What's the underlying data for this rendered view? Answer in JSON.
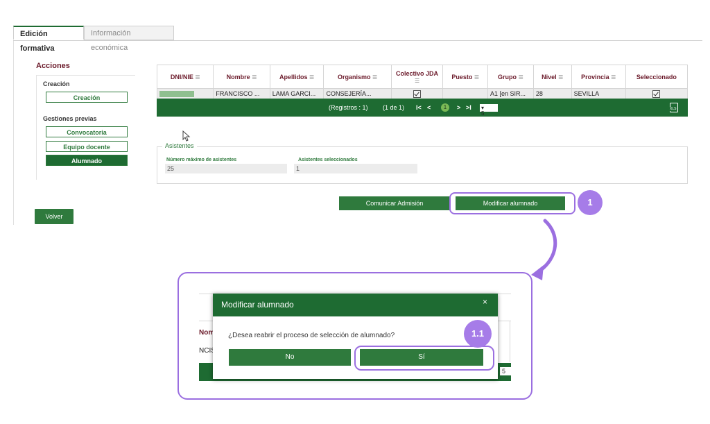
{
  "tabs": [
    {
      "label": "Edición formativa",
      "active": true
    },
    {
      "label": "Información económica",
      "active": false
    }
  ],
  "sidebar": {
    "title": "Acciones",
    "section_creacion": "Creación",
    "btn_creacion": "Creación",
    "section_gestiones": "Gestiones previas",
    "btn_convocatoria": "Convocatoria",
    "btn_equipo": "Equipo docente",
    "btn_alumnado": "Alumnado",
    "volver": "Volver"
  },
  "table": {
    "headers": [
      "DNI/NIE",
      "Nombre",
      "Apellidos",
      "Organismo",
      "Colectivo JDA",
      "Puesto",
      "Grupo",
      "Nivel",
      "Provincia",
      "Seleccionado"
    ],
    "row": {
      "nombre": "FRANCISCO ...",
      "apellidos": "LAMA GARCI...",
      "organismo": "CONSEJERÍA...",
      "puesto": "",
      "grupo": "A1 [en SIR...",
      "nivel": "28",
      "provincia": "SEVILLA"
    },
    "pager": {
      "registros": "(Registros : 1)",
      "pages": "(1 de 1)",
      "first": "I<",
      "prev": "<",
      "current": "1",
      "next": ">",
      "last": ">I",
      "per_page": "5"
    }
  },
  "asistentes": {
    "legend": "Asistentes",
    "max_label": "Número máximo de asistentes",
    "max_value": "25",
    "sel_label": "Asistentes seleccionados",
    "sel_value": "1"
  },
  "actions": {
    "comunicar": "Comunicar Admisión",
    "modificar": "Modificar alumnado",
    "step1": "1"
  },
  "modal": {
    "title": "Modificar alumnado",
    "close": "×",
    "question": "¿Desea reabrir el proceso de selección de alumnado?",
    "no": "No",
    "si": "Sí",
    "step": "1.1",
    "bg_text_nom": "Nom",
    "bg_text_ncis": "NCIS",
    "bg_text_5": "5"
  },
  "colors": {
    "primary_green": "#1e6b32",
    "button_green": "#2f7a3d",
    "highlight_purple": "#9b6fe0",
    "header_text": "#6b1a2a"
  }
}
